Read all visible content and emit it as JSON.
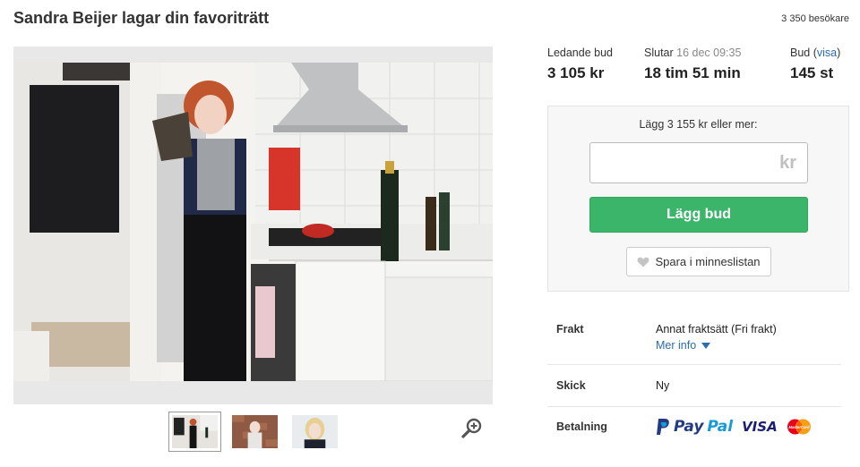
{
  "header": {
    "title": "Sandra Beijer lagar din favoriträtt",
    "visitors": "3 350 besökare"
  },
  "stats": {
    "leading_bid_label": "Ledande bud",
    "leading_bid_value": "3 105 kr",
    "ends_label": "Slutar",
    "ends_date": "16 dec 09:35",
    "ends_value": "18 tim 51 min",
    "bids_label": "Bud",
    "bids_link_open": "(",
    "bids_link": "visa",
    "bids_link_close": ")",
    "bids_value": "145 st"
  },
  "bid_box": {
    "hint": "Lägg 3 155 kr eller mer:",
    "input_placeholder": "kr",
    "button_label": "Lägg bud",
    "save_label": "Spara i minneslistan"
  },
  "details": {
    "shipping_label": "Frakt",
    "shipping_value": "Annat fraktsätt (Fri frakt)",
    "more_info": "Mer info",
    "condition_label": "Skick",
    "condition_value": "Ny",
    "payment_label": "Betalning",
    "paypal_pay": "Pay",
    "paypal_pal": "Pal",
    "visa": "VISA",
    "mastercard": "MasterCard"
  },
  "icons": {
    "heart": "heart-icon",
    "zoom": "zoom-in-icon",
    "caret": "caret-down-icon",
    "paypal_p": "paypal-p-icon"
  },
  "colors": {
    "primary_button": "#3bb56a",
    "link": "#2b6cb0"
  }
}
